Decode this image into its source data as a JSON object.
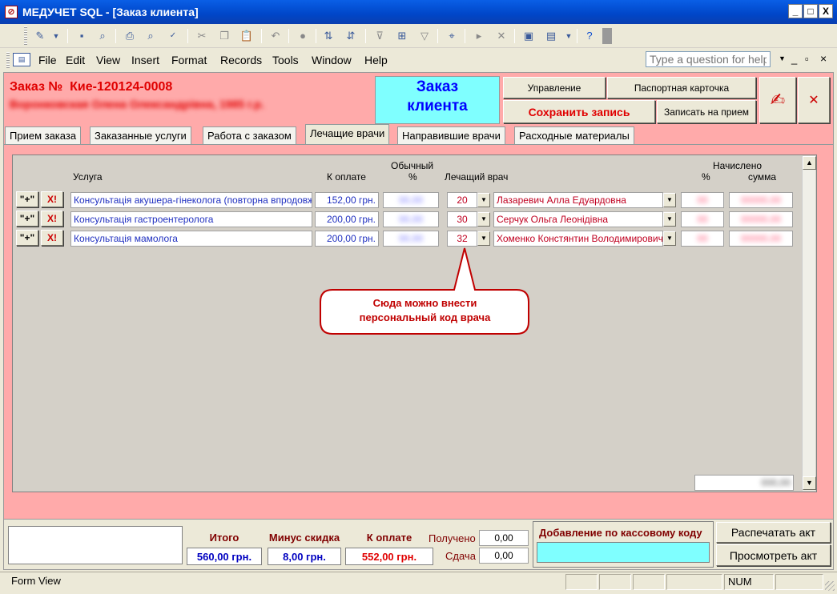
{
  "window": {
    "title": "МЕДУЧЕТ SQL - [Заказ клиента]",
    "app_icon": "access-icon",
    "controls": [
      "_",
      "□",
      "X"
    ]
  },
  "menu": {
    "items": [
      "File",
      "Edit",
      "View",
      "Insert",
      "Format",
      "Records",
      "Tools",
      "Window",
      "Help"
    ],
    "help_placeholder": "Type a question for help",
    "mdi_controls": [
      "_",
      "▫",
      "×"
    ]
  },
  "form": {
    "order_label": "Заказ №",
    "order_number": "Кие-120124-0008",
    "patient_name": "Воронковская Олена Олександрівна, 1985 г.р.",
    "title": "Заказ клиента",
    "buttons": {
      "manage": "Управление",
      "passport": "Паспортная карточка",
      "save": "Сохранить запись",
      "appointment": "Записать на прием"
    }
  },
  "tabs": [
    {
      "label": "Прием заказа",
      "active": false
    },
    {
      "label": "Заказанные услуги",
      "active": false
    },
    {
      "label": "Работа с заказом",
      "active": false
    },
    {
      "label": "Лечащие врачи",
      "active": true
    },
    {
      "label": "Направившие врачи",
      "active": false
    },
    {
      "label": "Расходные материалы",
      "active": false
    }
  ],
  "grid": {
    "headers": {
      "service": "Услуга",
      "to_pay": "К оплате",
      "usual_pct_1": "Обычный",
      "usual_pct_2": "%",
      "doctor": "Лечащий врач",
      "accrued": "Начислено",
      "pct": "%",
      "sum": "сумма"
    },
    "row_buttons": {
      "add": "\"+\"",
      "del": "X!"
    },
    "rows": [
      {
        "service": "Консультація акушера-гінеколога (повторна впродовж",
        "to_pay": "152,00 грн.",
        "usual_pct": "00,00",
        "doctor_code": "20",
        "doctor_name": "Лазаревич Алла Едуардовна",
        "pct": "00",
        "sum": "00000,00"
      },
      {
        "service": "Консультація гастроентеролога",
        "to_pay": "200,00 грн.",
        "usual_pct": "00,00",
        "doctor_code": "30",
        "doctor_name": "Серчук Ольга Леонідівна",
        "pct": "00",
        "sum": "00000,00"
      },
      {
        "service": "Консультація мамолога",
        "to_pay": "200,00 грн.",
        "usual_pct": "00,00",
        "doctor_code": "32",
        "doctor_name": "Хоменко Констянтин Володимирович",
        "pct": "00",
        "sum": "00000,00"
      }
    ],
    "footer_total": "000,00"
  },
  "callout": {
    "line1": "Сюда можно внести",
    "line2": "персональный код врача"
  },
  "totals": {
    "itogo_label": "Итого",
    "itogo_value": "560,00 грн.",
    "discount_label": "Минус скидка",
    "discount_value": "8,00 грн.",
    "to_pay_label": "К оплате",
    "to_pay_value": "552,00 грн.",
    "received_label": "Получено",
    "received_value": "0,00",
    "change_label": "Сдача",
    "change_value": "0,00",
    "cash_code_label": "Добавление по кассовому коду",
    "print_act": "Распечатать акт",
    "view_act": "Просмотреть акт"
  },
  "status": {
    "mode": "Form View",
    "num": "NUM"
  }
}
